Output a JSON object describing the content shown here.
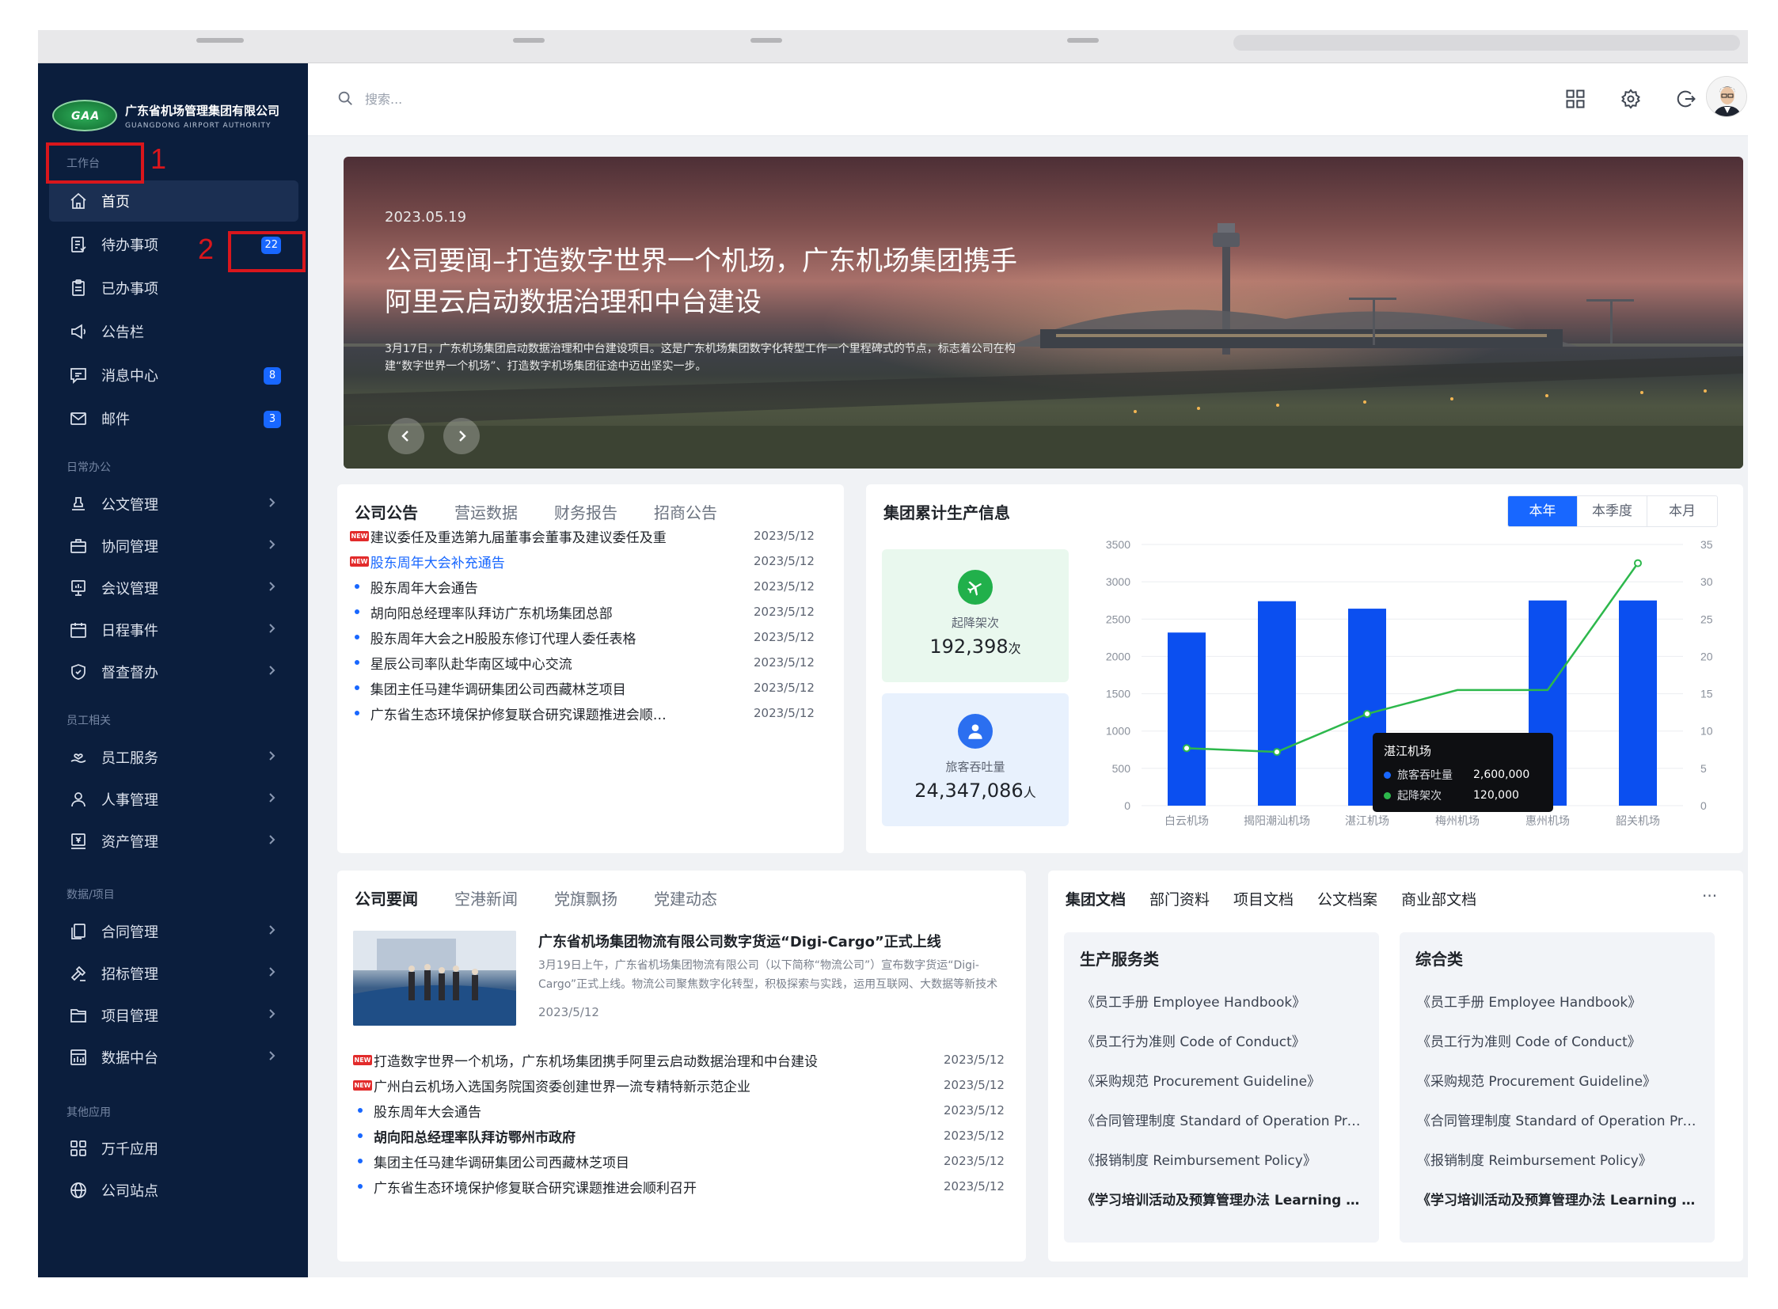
{
  "brand": {
    "emblem_text": "GAA",
    "name_cn": "广东省机场管理集团有限公司",
    "name_en": "GUANGDONG AIRPORT AUTHORITY"
  },
  "topbar": {
    "search_placeholder": "搜索..."
  },
  "annotations": {
    "mark1": "1",
    "mark2": "2"
  },
  "sidebar": {
    "sections": {
      "workbench": "工作台",
      "daily": "日常办公",
      "staff": "员工相关",
      "data": "数据/项目",
      "other": "其他应用"
    },
    "items": {
      "home": "首页",
      "todo": "待办事项",
      "todo_badge": "22",
      "done": "已办事项",
      "notice": "公告栏",
      "messages": "消息中心",
      "messages_badge": "8",
      "mail": "邮件",
      "mail_badge": "3",
      "doc_mgmt": "公文管理",
      "collab": "协同管理",
      "meeting": "会议管理",
      "schedule": "日程事件",
      "supervise": "督查督办",
      "staff_service": "员工服务",
      "hr": "人事管理",
      "assets": "资产管理",
      "contract": "合同管理",
      "bidding": "招标管理",
      "project": "项目管理",
      "data_center": "数据中台",
      "apps": "万千应用",
      "sites": "公司站点"
    }
  },
  "banner": {
    "date": "2023.05.19",
    "title": "公司要闻–打造数字世界一个机场，广东机场集团携手阿里云启动数据治理和中台建设",
    "desc": "3月17日，广东机场集团启动数据治理和中台建设项目。这是广东机场集团数字化转型工作一个里程碑式的节点，标志着公司在构建“数字世界一个机场”、打造数字机场集团征途中迈出坚实一步。"
  },
  "announce": {
    "tabs": [
      "公司公告",
      "营运数据",
      "财务报告",
      "招商公告"
    ],
    "rows": [
      {
        "text": "建议委任及重选第九届董事会董事及建议委任及重",
        "date": "2023/5/12",
        "marker": "new"
      },
      {
        "text": "股东周年大会补充通告",
        "date": "2023/5/12",
        "marker": "new"
      },
      {
        "text": "股东周年大会通告",
        "date": "2023/5/12",
        "marker": "dot"
      },
      {
        "text": "胡向阳总经理率队拜访广东机场集团总部",
        "date": "2023/5/12",
        "marker": "dot"
      },
      {
        "text": "股东周年大会之H股股东修订代理人委任表格",
        "date": "2023/5/12",
        "marker": "dot"
      },
      {
        "text": "星辰公司率队赴华南区域中心交流",
        "date": "2023/5/12",
        "marker": "dot"
      },
      {
        "text": "集团主任马建华调研集团公司西藏林芝项目",
        "date": "2023/5/12",
        "marker": "dot"
      },
      {
        "text": "广东省生态环境保护修复联合研究课题推进会顺利召开",
        "date": "2023/5/12",
        "marker": "dot"
      }
    ],
    "new_tag": "NEW",
    "highlight_color": "#1867ff"
  },
  "stats": {
    "title": "集团累计生产信息",
    "periods": [
      "本年",
      "本季度",
      "本月"
    ],
    "flights_label": "起降架次",
    "flights_value": "192,398",
    "flights_unit": "次",
    "passengers_label": "旅客吞吐量",
    "passengers_value": "24,347,086",
    "passengers_unit": "人",
    "tooltip": {
      "title": "湛江机场",
      "s1_label": "旅客吞吐量",
      "s1_value": "2,600,000",
      "s2_label": "起降架次",
      "s2_value": "120,000"
    }
  },
  "chart_data": {
    "type": "bar",
    "categories": [
      "白云机场",
      "揭阳潮汕机场",
      "湛江机场",
      "梅州机场",
      "惠州机场",
      "韶关机场"
    ],
    "series": [
      {
        "name": "旅客吞吐量",
        "type": "bar",
        "axis": "left",
        "values": [
          2320,
          2740,
          2640,
          700,
          2750,
          2750
        ],
        "color": "#0b4ff0"
      },
      {
        "name": "起降架次",
        "type": "line",
        "axis": "right",
        "values": [
          7.7,
          7.2,
          12.3,
          15.5,
          15.5,
          32.5
        ],
        "color": "#2db84c"
      }
    ],
    "yticks_left": [
      "0",
      "500",
      "1000",
      "1500",
      "2000",
      "2500",
      "3000",
      "3500"
    ],
    "yticks_right": [
      "0",
      "5",
      "10",
      "15",
      "20",
      "25",
      "30",
      "35"
    ],
    "ylim_left": [
      0,
      3500
    ],
    "ylim_right": [
      0,
      35
    ],
    "grid": true
  },
  "news": {
    "tabs": [
      "公司要闻",
      "空港新闻",
      "党旗飘扬",
      "党建动态"
    ],
    "featured": {
      "title": "广东省机场集团物流有限公司数字货运“Digi-Cargo”正式上线",
      "desc": "3月19日上午，广东省机场集团物流有限公司（以下简称“物流公司”）宣布数字货运“Digi-Cargo”正式上线。物流公司聚焦数字化转型，积极探索与实践，运用互联网、大数据等新技术赋能货运业务。",
      "date": "2023/5/12"
    },
    "rows": [
      {
        "text": "打造数字世界一个机场，广东机场集团携手阿里云启动数据治理和中台建设",
        "date": "2023/5/12",
        "marker": "new"
      },
      {
        "text": "广州白云机场入选国务院国资委创建世界一流专精特新示范企业",
        "date": "2023/5/12",
        "marker": "new"
      },
      {
        "text": "股东周年大会通告",
        "date": "2023/5/12",
        "marker": "dot"
      },
      {
        "text": "胡向阳总经理率队拜访鄂州市政府",
        "date": "2023/5/12",
        "marker": "dot"
      },
      {
        "text": "集团主任马建华调研集团公司西藏林芝项目",
        "date": "2023/5/12",
        "marker": "dot"
      },
      {
        "text": "广东省生态环境保护修复联合研究课题推进会顺利召开",
        "date": "2023/5/12",
        "marker": "dot"
      }
    ]
  },
  "docs": {
    "tabs": [
      "集团文档",
      "部门资料",
      "项目文档",
      "公文档案",
      "商业部文档"
    ],
    "more": "···",
    "columns": [
      {
        "heading": "生产服务类",
        "items": [
          "《员工手册 Employee Handbook》",
          "《员工行为准则 Code of Conduct》",
          "《采购规范 Procurement Guideline》",
          "《合同管理制度 Standard of Operation Procedure》",
          "《报销制度 Reimbursement Policy》",
          "《学习培训活动及预算管理办法 Learning and Development Policy》"
        ]
      },
      {
        "heading": "综合类",
        "items": [
          "《员工手册 Employee Handbook》",
          "《员工行为准则 Code of Conduct》",
          "《采购规范 Procurement Guideline》",
          "《合同管理制度 Standard of Operation Procedure》",
          "《报销制度 Reimbursement Policy》",
          "《学习培训活动及预算管理办法 Learning and Development Policy》"
        ]
      }
    ]
  }
}
